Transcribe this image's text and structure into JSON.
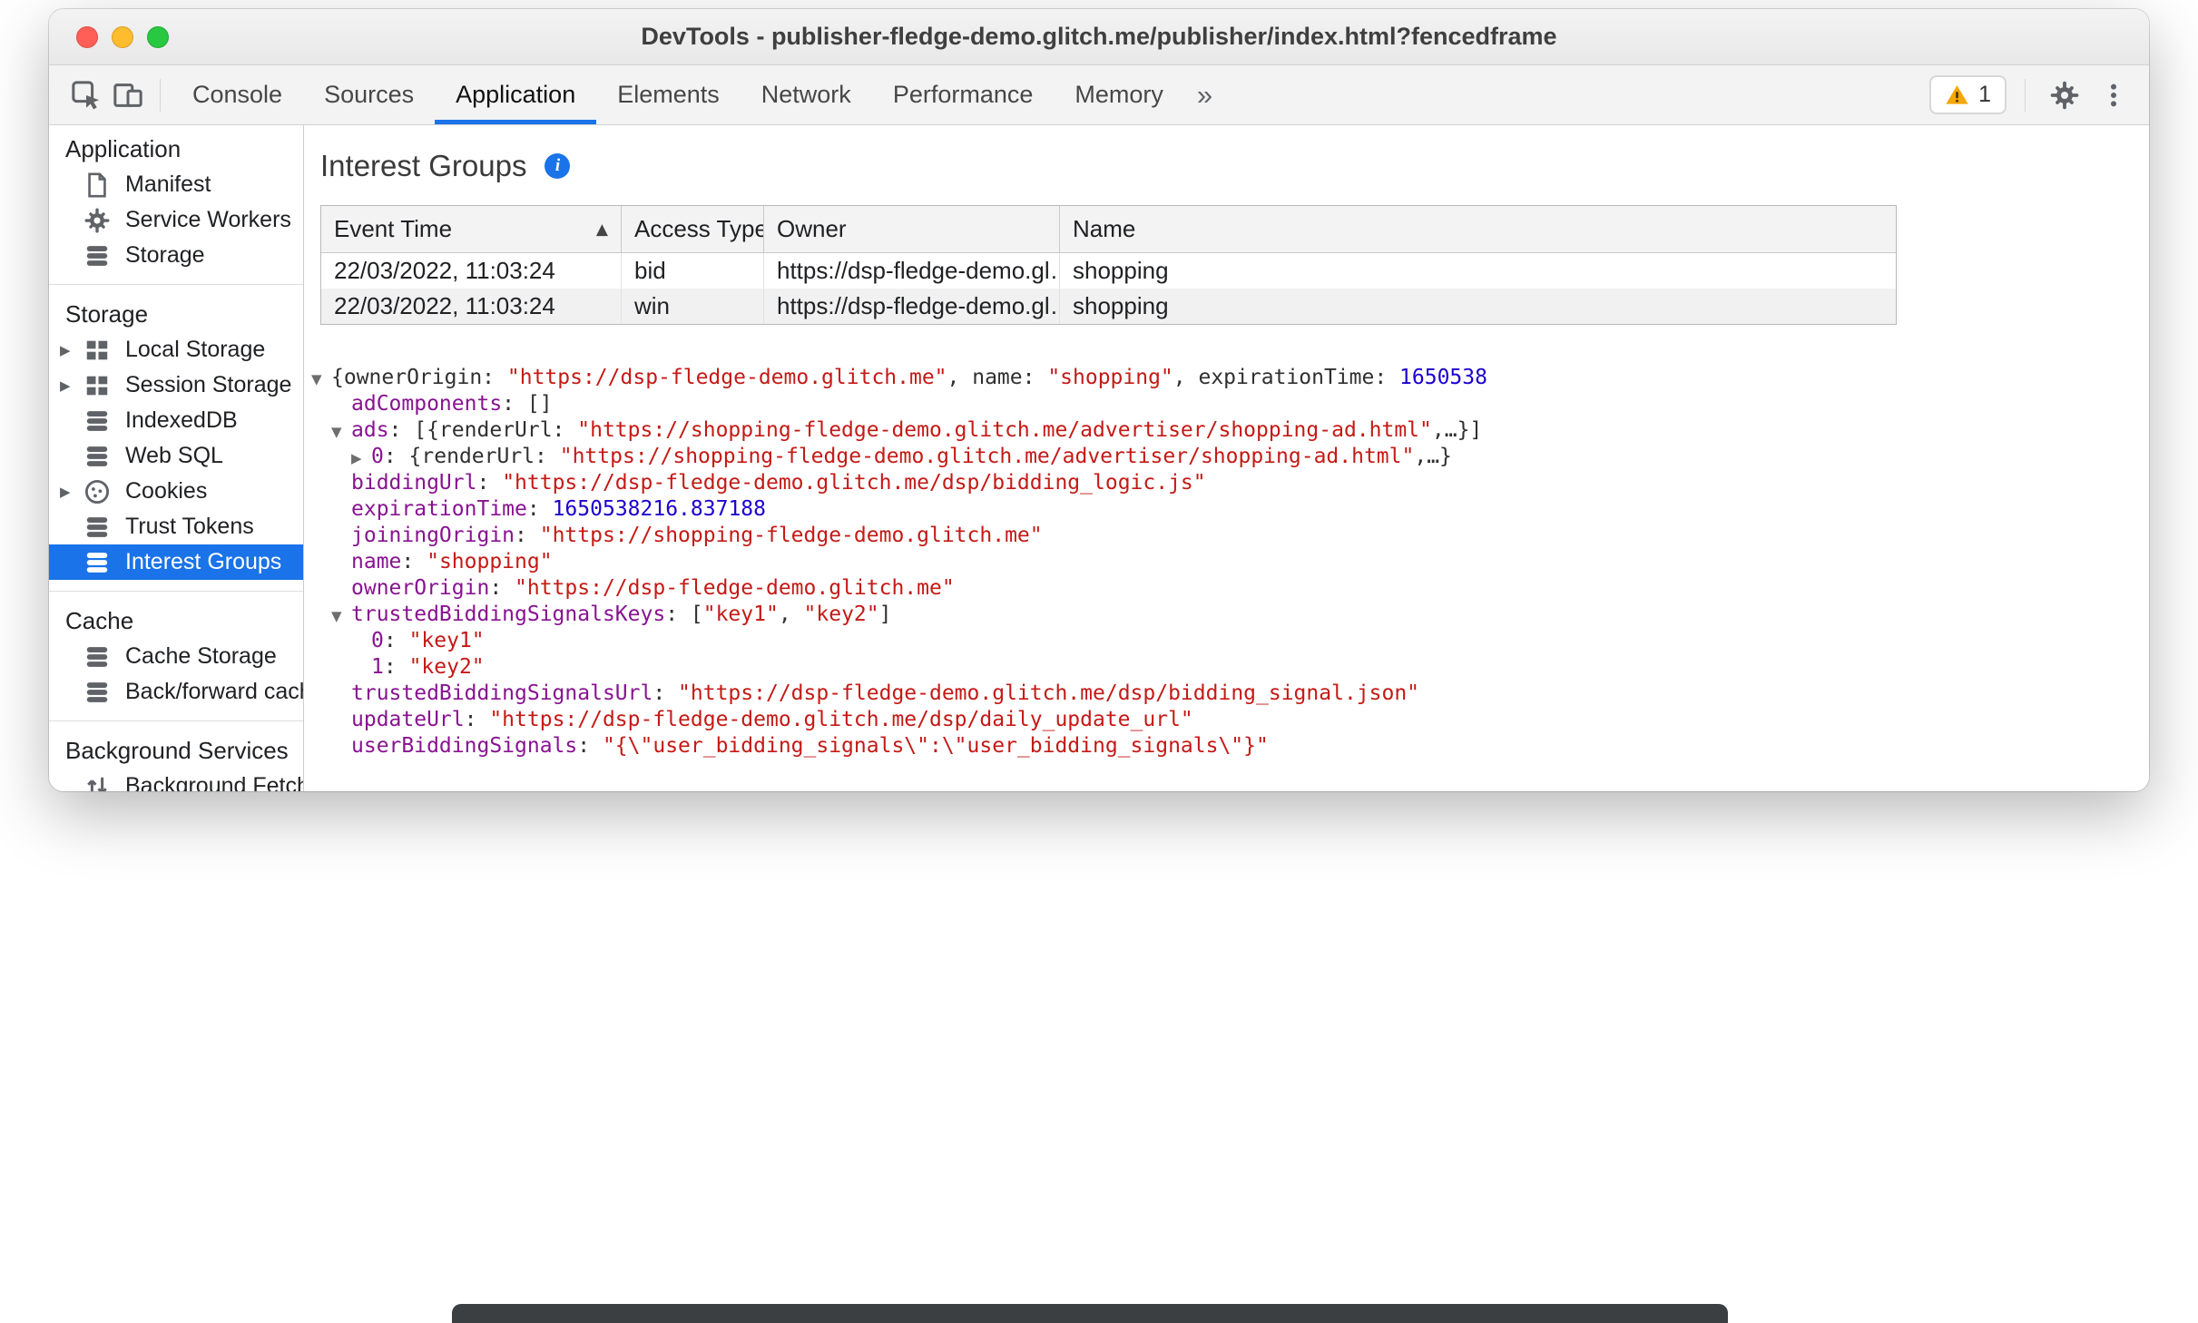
{
  "window": {
    "title": "DevTools - publisher-fledge-demo.glitch.me/publisher/index.html?fencedframe"
  },
  "toolbar": {
    "tabs": [
      {
        "label": "Console",
        "selected": false
      },
      {
        "label": "Sources",
        "selected": false
      },
      {
        "label": "Application",
        "selected": true
      },
      {
        "label": "Elements",
        "selected": false
      },
      {
        "label": "Network",
        "selected": false
      },
      {
        "label": "Performance",
        "selected": false
      },
      {
        "label": "Memory",
        "selected": false
      }
    ],
    "overflow_chevron": "»",
    "warning_count": "1"
  },
  "sidebar": {
    "sections": [
      {
        "title": "Application",
        "items": [
          {
            "label": "Manifest",
            "icon": "file-icon"
          },
          {
            "label": "Service Workers",
            "icon": "gear-icon"
          },
          {
            "label": "Storage",
            "icon": "database-icon"
          }
        ]
      },
      {
        "title": "Storage",
        "items": [
          {
            "label": "Local Storage",
            "icon": "table-icon",
            "expandable": true
          },
          {
            "label": "Session Storage",
            "icon": "table-icon",
            "expandable": true
          },
          {
            "label": "IndexedDB",
            "icon": "database-icon"
          },
          {
            "label": "Web SQL",
            "icon": "database-icon"
          },
          {
            "label": "Cookies",
            "icon": "cookie-icon",
            "expandable": true
          },
          {
            "label": "Trust Tokens",
            "icon": "database-icon"
          },
          {
            "label": "Interest Groups",
            "icon": "database-icon",
            "selected": true
          }
        ]
      },
      {
        "title": "Cache",
        "items": [
          {
            "label": "Cache Storage",
            "icon": "database-icon"
          },
          {
            "label": "Back/forward cach",
            "icon": "database-icon"
          }
        ]
      },
      {
        "title": "Background Services",
        "items": [
          {
            "label": "Background Fetch",
            "icon": "fetch-icon"
          }
        ]
      }
    ]
  },
  "main": {
    "title": "Interest Groups",
    "table": {
      "columns": [
        {
          "label": "Event Time",
          "sort": "asc"
        },
        {
          "label": "Access Type"
        },
        {
          "label": "Owner"
        },
        {
          "label": "Name"
        }
      ],
      "rows": [
        {
          "cells": [
            "22/03/2022, 11:03:24",
            "bid",
            "https://dsp-fledge-demo.gl…",
            "shopping"
          ]
        },
        {
          "cells": [
            "22/03/2022, 11:03:24",
            "win",
            "https://dsp-fledge-demo.gl…",
            "shopping"
          ]
        }
      ]
    },
    "tree": {
      "lines": [
        {
          "indent": 0,
          "arrow": "down",
          "segments": [
            {
              "t": "{ownerOrigin: ",
              "c": "plain"
            },
            {
              "t": "\"https://dsp-fledge-demo.glitch.me\"",
              "c": "string"
            },
            {
              "t": ", name: ",
              "c": "plain"
            },
            {
              "t": "\"shopping\"",
              "c": "string"
            },
            {
              "t": ", expirationTime: ",
              "c": "plain"
            },
            {
              "t": "1650538",
              "c": "number"
            }
          ]
        },
        {
          "indent": 1,
          "arrow": "none",
          "segments": [
            {
              "t": "adComponents",
              "c": "key"
            },
            {
              "t": ": []",
              "c": "plain"
            }
          ]
        },
        {
          "indent": 1,
          "arrow": "down",
          "segments": [
            {
              "t": "ads",
              "c": "key"
            },
            {
              "t": ": [{renderUrl: ",
              "c": "plain"
            },
            {
              "t": "\"https://shopping-fledge-demo.glitch.me/advertiser/shopping-ad.html\"",
              "c": "string"
            },
            {
              "t": ",…}]",
              "c": "plain"
            }
          ]
        },
        {
          "indent": 2,
          "arrow": "right",
          "segments": [
            {
              "t": "0",
              "c": "key"
            },
            {
              "t": ": {renderUrl: ",
              "c": "plain"
            },
            {
              "t": "\"https://shopping-fledge-demo.glitch.me/advertiser/shopping-ad.html\"",
              "c": "string"
            },
            {
              "t": ",…}",
              "c": "plain"
            }
          ]
        },
        {
          "indent": 1,
          "arrow": "none",
          "segments": [
            {
              "t": "biddingUrl",
              "c": "key"
            },
            {
              "t": ": ",
              "c": "plain"
            },
            {
              "t": "\"https://dsp-fledge-demo.glitch.me/dsp/bidding_logic.js\"",
              "c": "string"
            }
          ]
        },
        {
          "indent": 1,
          "arrow": "none",
          "segments": [
            {
              "t": "expirationTime",
              "c": "key"
            },
            {
              "t": ": ",
              "c": "plain"
            },
            {
              "t": "1650538216.837188",
              "c": "number"
            }
          ]
        },
        {
          "indent": 1,
          "arrow": "none",
          "segments": [
            {
              "t": "joiningOrigin",
              "c": "key"
            },
            {
              "t": ": ",
              "c": "plain"
            },
            {
              "t": "\"https://shopping-fledge-demo.glitch.me\"",
              "c": "string"
            }
          ]
        },
        {
          "indent": 1,
          "arrow": "none",
          "segments": [
            {
              "t": "name",
              "c": "key"
            },
            {
              "t": ": ",
              "c": "plain"
            },
            {
              "t": "\"shopping\"",
              "c": "string"
            }
          ]
        },
        {
          "indent": 1,
          "arrow": "none",
          "segments": [
            {
              "t": "ownerOrigin",
              "c": "key"
            },
            {
              "t": ": ",
              "c": "plain"
            },
            {
              "t": "\"https://dsp-fledge-demo.glitch.me\"",
              "c": "string"
            }
          ]
        },
        {
          "indent": 1,
          "arrow": "down",
          "segments": [
            {
              "t": "trustedBiddingSignalsKeys",
              "c": "key"
            },
            {
              "t": ": [",
              "c": "plain"
            },
            {
              "t": "\"key1\"",
              "c": "string"
            },
            {
              "t": ", ",
              "c": "plain"
            },
            {
              "t": "\"key2\"",
              "c": "string"
            },
            {
              "t": "]",
              "c": "plain"
            }
          ]
        },
        {
          "indent": 2,
          "arrow": "none",
          "segments": [
            {
              "t": "0",
              "c": "key"
            },
            {
              "t": ": ",
              "c": "plain"
            },
            {
              "t": "\"key1\"",
              "c": "string"
            }
          ]
        },
        {
          "indent": 2,
          "arrow": "none",
          "segments": [
            {
              "t": "1",
              "c": "key"
            },
            {
              "t": ": ",
              "c": "plain"
            },
            {
              "t": "\"key2\"",
              "c": "string"
            }
          ]
        },
        {
          "indent": 1,
          "arrow": "none",
          "segments": [
            {
              "t": "trustedBiddingSignalsUrl",
              "c": "key"
            },
            {
              "t": ": ",
              "c": "plain"
            },
            {
              "t": "\"https://dsp-fledge-demo.glitch.me/dsp/bidding_signal.json\"",
              "c": "string"
            }
          ]
        },
        {
          "indent": 1,
          "arrow": "none",
          "segments": [
            {
              "t": "updateUrl",
              "c": "key"
            },
            {
              "t": ": ",
              "c": "plain"
            },
            {
              "t": "\"https://dsp-fledge-demo.glitch.me/dsp/daily_update_url\"",
              "c": "string"
            }
          ]
        },
        {
          "indent": 1,
          "arrow": "none",
          "segments": [
            {
              "t": "userBiddingSignals",
              "c": "key"
            },
            {
              "t": ": ",
              "c": "plain"
            },
            {
              "t": "\"{\\\"user_bidding_signals\\\":\\\"user_bidding_signals\\\"}\"",
              "c": "string"
            }
          ]
        }
      ]
    }
  },
  "colors": {
    "accent": "#1a73e8",
    "selected_item_bg": "#1a73e8",
    "tree_key": "#881391",
    "tree_string": "#c41a16",
    "tree_number": "#1c00cf",
    "warning": "#f6a609",
    "traffic_red": "#ff5f57",
    "traffic_yellow": "#febc2e",
    "traffic_green": "#28c840"
  }
}
